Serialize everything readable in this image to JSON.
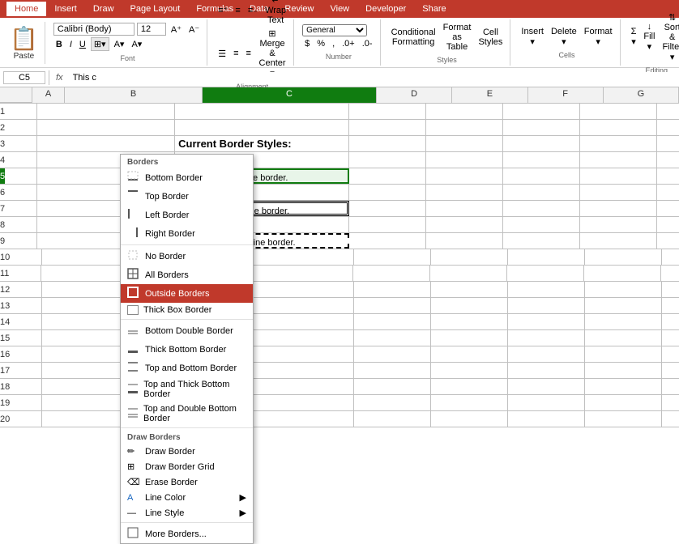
{
  "ribbon": {
    "tabs": [
      "Home",
      "Insert",
      "Draw",
      "Page Layout",
      "Formulas",
      "Data",
      "Review",
      "View",
      "Developer"
    ],
    "active_tab": "Home"
  },
  "toolbar": {
    "paste_label": "Paste",
    "font_name": "Calibri (Body)",
    "font_size": "12",
    "bold": "B",
    "italic": "I",
    "underline": "U",
    "wrap_text": "Wrap Text",
    "merge_center": "Merge & Center",
    "number_format": "General",
    "conditional_formatting": "Conditional Formatting",
    "format_as_table": "Format as Table",
    "cell_styles": "Cell Styles",
    "insert": "Insert",
    "delete": "Delete",
    "format": "Format",
    "sort_filter": "Sort & Filter"
  },
  "formula_bar": {
    "cell_ref": "C5",
    "fx": "fx",
    "formula_text": "This c"
  },
  "borders_menu": {
    "title": "Borders",
    "items": [
      {
        "id": "bottom-border",
        "label": "Bottom Border",
        "icon": "bottom",
        "active": false,
        "has_checkbox": false,
        "has_arrow": false
      },
      {
        "id": "top-border",
        "label": "Top Border",
        "icon": "top",
        "active": false,
        "has_checkbox": false,
        "has_arrow": false
      },
      {
        "id": "left-border",
        "label": "Left Border",
        "icon": "left",
        "active": false,
        "has_checkbox": false,
        "has_arrow": false
      },
      {
        "id": "right-border",
        "label": "Right Border",
        "icon": "right",
        "active": false,
        "has_checkbox": false,
        "has_arrow": false
      },
      {
        "id": "divider1",
        "label": "",
        "type": "divider"
      },
      {
        "id": "no-border",
        "label": "No Border",
        "icon": "none",
        "active": false,
        "has_checkbox": false,
        "has_arrow": false
      },
      {
        "id": "all-borders",
        "label": "All Borders",
        "icon": "all",
        "active": false,
        "has_checkbox": false,
        "has_arrow": false
      },
      {
        "id": "outside-borders",
        "label": "Outside Borders",
        "icon": "outside",
        "active": true,
        "has_checkbox": false,
        "has_arrow": false
      },
      {
        "id": "thick-box-border",
        "label": "Thick Box Border",
        "icon": "thick",
        "active": false,
        "has_checkbox": true,
        "has_arrow": false
      },
      {
        "id": "divider2",
        "label": "",
        "type": "divider"
      },
      {
        "id": "bottom-double",
        "label": "Bottom Double Border",
        "icon": "bottom-double",
        "active": false,
        "has_checkbox": false,
        "has_arrow": false
      },
      {
        "id": "thick-bottom",
        "label": "Thick Bottom Border",
        "icon": "thick-bottom",
        "active": false,
        "has_checkbox": false,
        "has_arrow": false
      },
      {
        "id": "top-bottom",
        "label": "Top and Bottom Border",
        "icon": "top-bottom",
        "active": false,
        "has_checkbox": false,
        "has_arrow": false
      },
      {
        "id": "top-thick-bottom",
        "label": "Top and Thick Bottom Border",
        "icon": "top-thick-bottom",
        "active": false,
        "has_checkbox": false,
        "has_arrow": false
      },
      {
        "id": "top-double-bottom",
        "label": "Top and Double Bottom Border",
        "icon": "top-double-bottom",
        "active": false,
        "has_checkbox": false,
        "has_arrow": false
      },
      {
        "id": "divider3",
        "label": "",
        "type": "divider"
      },
      {
        "id": "draw-borders-label",
        "label": "Draw Borders",
        "type": "section-label"
      },
      {
        "id": "draw-border",
        "label": "Draw Border",
        "icon": "draw",
        "active": false,
        "has_checkbox": false,
        "has_arrow": false
      },
      {
        "id": "draw-border-grid",
        "label": "Draw Border Grid",
        "icon": "grid",
        "active": false,
        "has_checkbox": false,
        "has_arrow": false
      },
      {
        "id": "erase-border",
        "label": "Erase Border",
        "icon": "erase",
        "active": false,
        "has_checkbox": false,
        "has_arrow": false
      },
      {
        "id": "line-color",
        "label": "Line Color",
        "icon": "color",
        "active": false,
        "has_checkbox": false,
        "has_arrow": true
      },
      {
        "id": "line-style",
        "label": "Line Style",
        "icon": "style",
        "active": false,
        "has_checkbox": false,
        "has_arrow": true
      },
      {
        "id": "divider4",
        "label": "",
        "type": "divider"
      },
      {
        "id": "more-borders",
        "label": "More Borders...",
        "icon": "more",
        "active": false,
        "has_checkbox": false,
        "has_arrow": false
      }
    ]
  },
  "spreadsheet": {
    "columns": [
      "A",
      "B",
      "C",
      "D",
      "E",
      "F",
      "G"
    ],
    "active_cell": "C5",
    "active_col": "C",
    "active_row": 5,
    "rows": [
      {
        "num": 1,
        "cells": {
          "A": "",
          "B": "",
          "C": "",
          "D": "",
          "E": "",
          "F": "",
          "G": ""
        }
      },
      {
        "num": 2,
        "cells": {
          "A": "",
          "B": "",
          "C": "",
          "D": "",
          "E": "",
          "F": "",
          "G": ""
        }
      },
      {
        "num": 3,
        "cells": {
          "A": "",
          "B": "",
          "C": "Current Border Styles:",
          "D": "",
          "E": "",
          "F": "",
          "G": ""
        }
      },
      {
        "num": 4,
        "cells": {
          "A": "",
          "B": "",
          "C": "",
          "D": "",
          "E": "",
          "F": "",
          "G": ""
        }
      },
      {
        "num": 5,
        "cells": {
          "A": "",
          "B": "",
          "C": "rounded by a single border.",
          "D": "",
          "E": "",
          "F": "",
          "G": ""
        }
      },
      {
        "num": 6,
        "cells": {
          "A": "",
          "B": "",
          "C": "",
          "D": "",
          "E": "",
          "F": "",
          "G": ""
        }
      },
      {
        "num": 7,
        "cells": {
          "A": "",
          "B": "",
          "C": "ounded by a double border.",
          "D": "",
          "E": "",
          "F": "",
          "G": ""
        }
      },
      {
        "num": 8,
        "cells": {
          "A": "",
          "B": "",
          "C": "",
          "D": "",
          "E": "",
          "F": "",
          "G": ""
        }
      },
      {
        "num": 9,
        "cells": {
          "A": "",
          "B": "",
          "C": "nded by a broken line border.",
          "D": "",
          "E": "",
          "F": "",
          "G": ""
        }
      },
      {
        "num": 10,
        "cells": {
          "A": "",
          "B": "",
          "C": "",
          "D": "",
          "E": "",
          "F": "",
          "G": ""
        }
      },
      {
        "num": 11,
        "cells": {
          "A": "",
          "B": "",
          "C": "",
          "D": "",
          "E": "",
          "F": "",
          "G": ""
        }
      },
      {
        "num": 12,
        "cells": {
          "A": "",
          "B": "",
          "C": "",
          "D": "",
          "E": "",
          "F": "",
          "G": ""
        }
      },
      {
        "num": 13,
        "cells": {
          "A": "",
          "B": "",
          "C": "",
          "D": "",
          "E": "",
          "F": "",
          "G": ""
        }
      },
      {
        "num": 14,
        "cells": {
          "A": "",
          "B": "",
          "C": "",
          "D": "",
          "E": "",
          "F": "",
          "G": ""
        }
      },
      {
        "num": 15,
        "cells": {
          "A": "",
          "B": "",
          "C": "",
          "D": "",
          "E": "",
          "F": "",
          "G": ""
        }
      },
      {
        "num": 16,
        "cells": {
          "A": "",
          "B": "",
          "C": "",
          "D": "",
          "E": "",
          "F": "",
          "G": ""
        }
      },
      {
        "num": 17,
        "cells": {
          "A": "",
          "B": "",
          "C": "",
          "D": "",
          "E": "",
          "F": "",
          "G": ""
        }
      },
      {
        "num": 18,
        "cells": {
          "A": "",
          "B": "",
          "C": "",
          "D": "",
          "E": "",
          "F": "",
          "G": ""
        }
      },
      {
        "num": 19,
        "cells": {
          "A": "",
          "B": "",
          "C": "",
          "D": "",
          "E": "",
          "F": "",
          "G": ""
        }
      },
      {
        "num": 20,
        "cells": {
          "A": "",
          "B": "",
          "C": "",
          "D": "",
          "E": "",
          "F": "",
          "G": ""
        }
      }
    ]
  },
  "share_button": "Share"
}
